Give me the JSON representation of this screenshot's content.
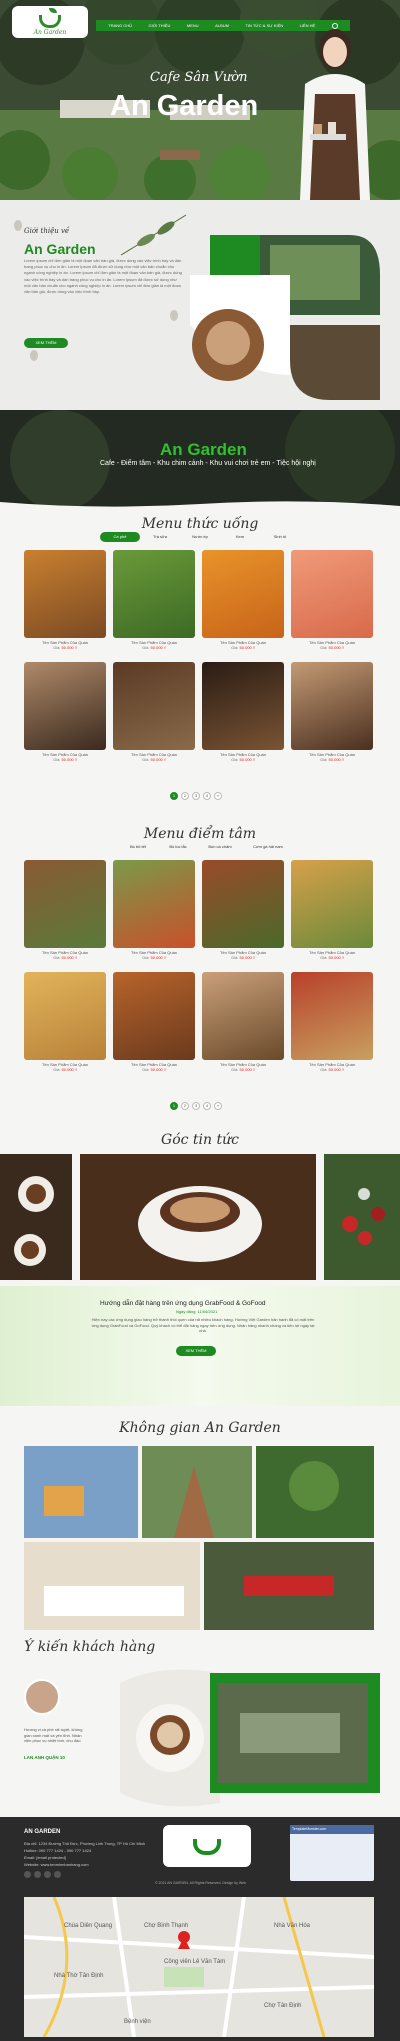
{
  "colors": {
    "brand": "#1e8a22",
    "price": "#d22222",
    "dark": "#2b2b2b"
  },
  "header": {
    "logo_text": "An Garden",
    "nav": [
      "TRANG CHỦ",
      "GIỚI THIỆU",
      "MENU",
      "ALBUM",
      "TIN TỨC & SỰ KIỆN",
      "LIÊN HỆ"
    ],
    "hero_subtitle": "Cafe Sân Vườn",
    "hero_title": "An Garden"
  },
  "about": {
    "subtitle": "Giới thiệu về",
    "title": "An Garden",
    "text": "Lorem ipsum chỉ đơn giản là một đoạn văn bản giả, được dùng vào việc trình bày và dàn trang phục vụ cho in ấn. Lorem Ipsum đã được sử dụng như một văn bản chuẩn cho ngành công nghiệp in ấn. Lorem ipsum chỉ đơn giản là một đoạn văn bản giả, được dùng vào việc trình bày và dàn trang phục vụ cho in ấn. Lorem Ipsum đã được sử dụng như một văn bản chuẩn cho ngành công nghiệp in ấn. Lorem ipsum chỉ đơn giản là một đoạn văn bản giả, được dùng vào việc trình bày.",
    "button": "XEM THÊM"
  },
  "banner": {
    "title": "An Garden",
    "subtitle": "Cafe - Điểm tâm - Khu chim cảnh - Khu vui chơi trẻ em - Tiệc hội nghị"
  },
  "menu_drinks": {
    "title": "Menu thức uống",
    "tabs": [
      "Cà phê",
      "Trà sữa",
      "Nước ép",
      "Kem",
      "Sinh tố"
    ],
    "product_name": "Tên Sản Phẩm Của Quán",
    "price_label": "Giá:",
    "price": "50.000 ₫",
    "pages": [
      "1",
      "2",
      "3",
      "4",
      "»"
    ]
  },
  "menu_food": {
    "title": "Menu điểm tâm",
    "tabs": [
      "Bò bít tết",
      "Bò lúc lắc",
      "Bún cá chấm",
      "Cơm gà hải nam"
    ],
    "product_name": "Tên Sản Phẩm Của Quán",
    "price_label": "Giá:",
    "price": "50.000 ₫",
    "pages": [
      "1",
      "2",
      "3",
      "4",
      "»"
    ]
  },
  "corner": {
    "title": "Góc tin tức"
  },
  "notice": {
    "title": "Hướng dẫn đặt hàng trên ứng dụng GrabFood & GoFood",
    "date": "Ngày đăng: 11/04/2021",
    "text": "Hiện nay các ứng dụng giao hàng trở thành thói quen của rất nhiều khách hàng. Hướng Việt Garden hân hạnh đã có mặt trên ứng dụng GrabFood và GoFood. Quý khách có thể đặt hàng ngay trên ứng dụng. Nhận hàng nhanh chóng và tiện lợi ngay tại nhà.",
    "button": "XEM THÊM"
  },
  "space": {
    "title": "Không gian An Garden"
  },
  "reviews": {
    "title": "Ý kiến khách hàng",
    "text": "Hương vị cà phê rất tuyệt, không gian xanh mát và yên tĩnh. Nhân viên phục vụ nhiệt tình, chu đáo.",
    "name": "LAN ANH QUẬN 10"
  },
  "footer": {
    "title": "AN GARDEN",
    "lines": [
      "Địa chỉ: 1234 Đường Thủ Đức, Phường Linh Trung, TP Hồ Chí Minh",
      "Hotline: 090 777 1424 - 090 777 1424",
      "Email: [email protected]",
      "Website: www.tenmienbanhang.com"
    ],
    "copyright": "© 2021 AN GARDEN. All Rights Reserved. Design by Web",
    "fb_label": "TemplateMonster.com"
  },
  "map": {
    "labels": [
      "Chùa Diên Quang",
      "Chợ Bình Thạnh",
      "Nhà Văn Hóa",
      "Công viên Lê Văn Tám",
      "Nhà Thờ Tân Định",
      "Chợ Tân Định",
      "Bệnh viện"
    ]
  }
}
